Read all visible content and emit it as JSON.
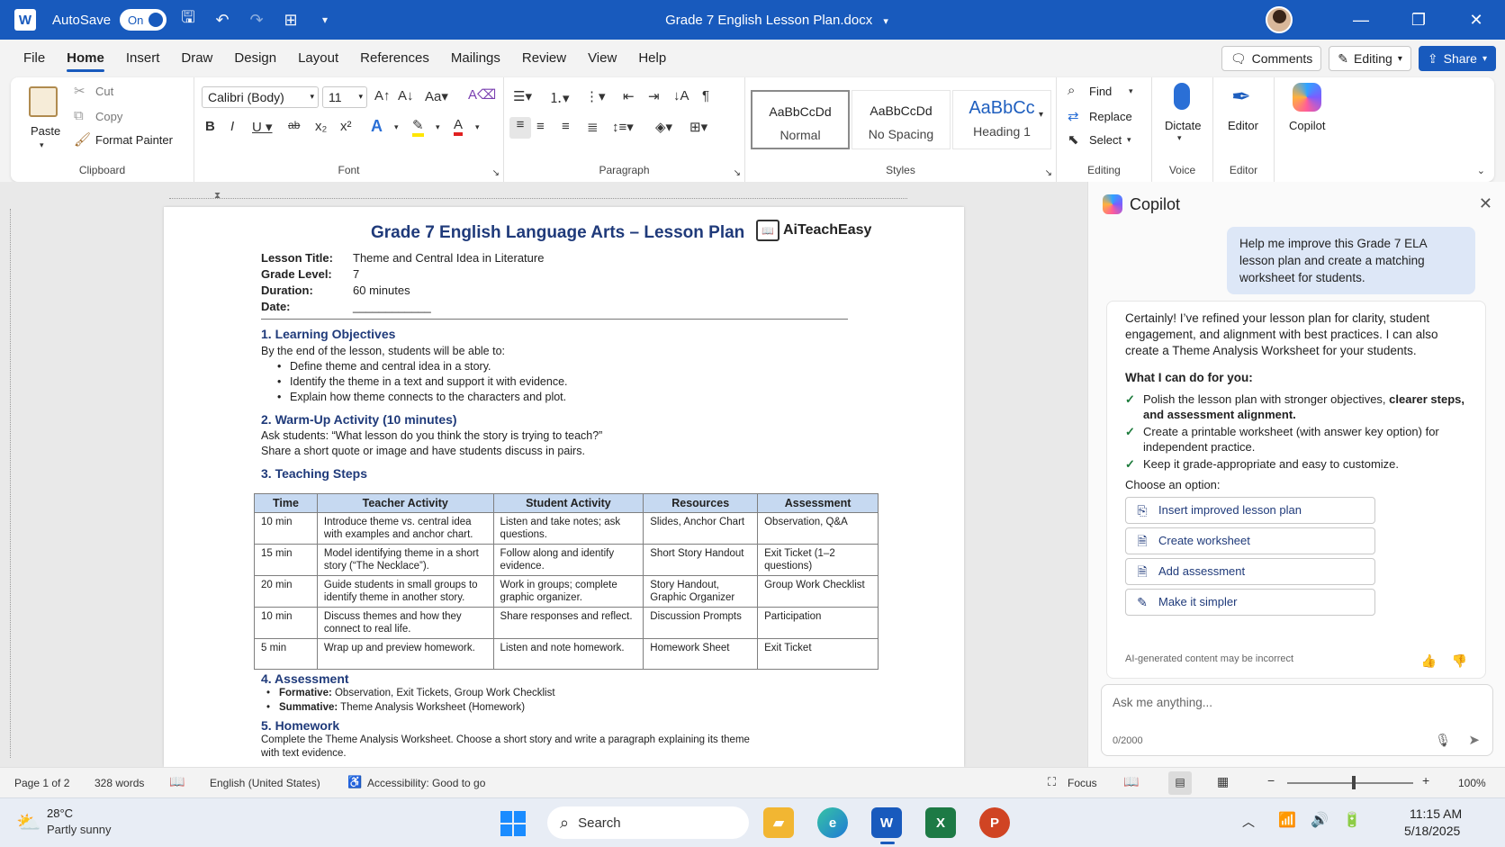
{
  "titlebar": {
    "app_letter": "W",
    "autosave_label": "AutoSave",
    "toggle_label": "On",
    "doc_title": "Grade 7 English Lesson Plan.docx",
    "minimize": "—",
    "restore": "❐",
    "close": "✕"
  },
  "menu": {
    "items": [
      "File",
      "Home",
      "Insert",
      "Draw",
      "Design",
      "Layout",
      "References",
      "Mailings",
      "Review",
      "View",
      "Help"
    ],
    "comments": "Comments",
    "editing": "Editing",
    "share": "Share"
  },
  "ribbon": {
    "clipboard": {
      "paste": "Paste",
      "cut": "Cut",
      "copy": "Copy",
      "format_painter": "Format Painter",
      "label": "Clipboard"
    },
    "font": {
      "font_name": "Calibri (Body)",
      "font_size": "11",
      "label": "Font"
    },
    "paragraph": {
      "label": "Paragraph"
    },
    "styles": {
      "items": [
        {
          "preview": "AaBbCcDd",
          "name": "Normal"
        },
        {
          "preview": "AaBbCcDd",
          "name": "No Spacing"
        },
        {
          "preview": "AaBbCc",
          "name": "Heading 1"
        }
      ],
      "label": "Styles"
    },
    "editing": {
      "find": "Find",
      "replace": "Replace",
      "select": "Select",
      "label": "Editing"
    },
    "voice": {
      "dictate": "Dictate",
      "label": "Voice"
    },
    "editor": {
      "editor": "Editor",
      "label": "Editor"
    },
    "copilot": {
      "copilot": "Copilot"
    }
  },
  "document": {
    "title": "Grade 7 English Language Arts – Lesson Plan",
    "logo_text": "AiTeachEasy",
    "meta": [
      {
        "label": "Lesson Title:",
        "value": "Theme and Central Idea in Literature"
      },
      {
        "label": "Grade Level:",
        "value": "7"
      },
      {
        "label": "Duration:",
        "value": "60 minutes"
      },
      {
        "label": "Date:",
        "value": "____________"
      }
    ],
    "s1_heading": "1. Learning Objectives",
    "s1_intro": "By the end of the lesson, students will be able to:",
    "s1_items": [
      "Define theme and central idea in a story.",
      "Identify the theme in a text and support it with evidence.",
      "Explain how theme connects to the characters and plot."
    ],
    "s2_heading": "2. Warm-Up Activity (10 minutes)",
    "s2_line1": "Ask students: “What lesson do you think the story is trying to teach?”",
    "s2_line2": "Share a short quote or image and have students discuss in pairs.",
    "s3_heading": "3. Teaching Steps",
    "table": {
      "headers": [
        "Time",
        "Teacher Activity",
        "Student Activity",
        "Resources",
        "Assessment"
      ],
      "rows": [
        [
          "10 min",
          "Introduce theme vs. central idea with examples and anchor chart.",
          "Listen and take notes; ask questions.",
          "Slides, Anchor Chart",
          "Observation, Q&A"
        ],
        [
          "15 min",
          "Model identifying theme in a short story (“The Necklace”).",
          "Follow along and identify evidence.",
          "Short Story Handout",
          "Exit Ticket (1–2 questions)"
        ],
        [
          "20 min",
          "Guide students in small groups to identify theme in another story.",
          "Work in groups; complete graphic organizer.",
          "Story Handout, Graphic Organizer",
          "Group Work Checklist"
        ],
        [
          "10 min",
          "Discuss themes and how they connect to real life.",
          "Share responses and reflect.",
          "Discussion Prompts",
          "Participation"
        ],
        [
          "5 min",
          "Wrap up and preview homework.",
          "Listen and note homework.",
          "Homework Sheet",
          "Exit Ticket"
        ]
      ]
    },
    "s4_heading": "4. Assessment",
    "s4_items": [
      {
        "label": "Formative:",
        "text": " Observation, Exit Tickets, Group Work Checklist"
      },
      {
        "label": "Summative:",
        "text": " Theme Analysis Worksheet (Homework)"
      }
    ],
    "s5_heading": "5. Homework",
    "s5_line1": "Complete the Theme Analysis Worksheet. Choose a short story and write a paragraph explaining its theme",
    "s5_line2": "with text evidence."
  },
  "copilot": {
    "title": "Copilot",
    "user_message": "Help me improve this Grade 7 ELA lesson plan and create a matching worksheet for students.",
    "response_intro": "Certainly! I’ve refined your lesson plan for clarity, student engagement, and alignment with best practices. I can also create a Theme Analysis Worksheet for your students.",
    "can_do_heading": "What I can do for you:",
    "can_do": [
      {
        "text": "Polish the lesson plan with stronger objectives, ",
        "bold": "clearer steps, and assessment alignment."
      },
      {
        "text": "Create a printable worksheet (with answer key option) for independent practice.",
        "bold": ""
      },
      {
        "text": "Keep it grade-appropriate and easy to customize.",
        "bold": ""
      }
    ],
    "choose": "Choose an option:",
    "options": [
      "Insert improved lesson plan",
      "Create worksheet",
      "Add assessment",
      "Make it simpler"
    ],
    "disclaimer": "AI-generated content may be incorrect",
    "ask_placeholder": "Ask me anything...",
    "char_count": "0/2000"
  },
  "status": {
    "page": "Page 1 of 2",
    "words": "328 words",
    "language": "English (United States)",
    "accessibility": "Accessibility: Good to go",
    "focus": "Focus",
    "zoom": "100%"
  },
  "taskbar": {
    "temp": "28°C",
    "weather": "Partly sunny",
    "search": "Search",
    "time": "11:15 AM",
    "date": "5/18/2025"
  }
}
